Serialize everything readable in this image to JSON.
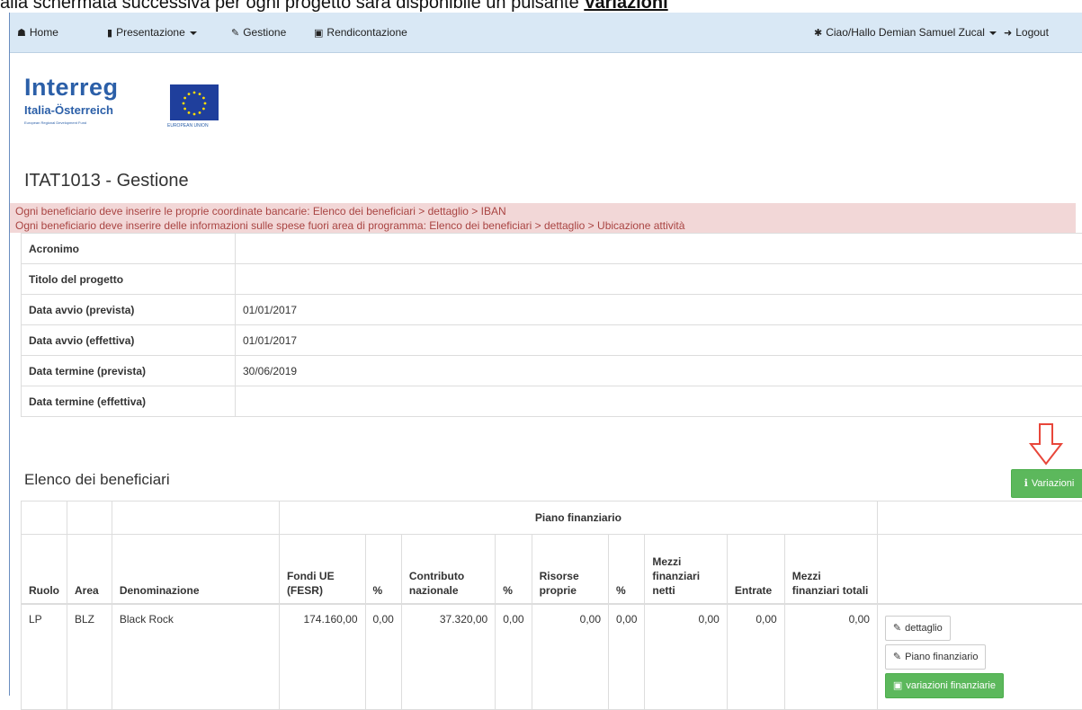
{
  "caption": {
    "text": "alla schermata successiva per ogni progetto sarà disponibile un pulsante ",
    "emphasis": "Variazioni"
  },
  "navbar": {
    "home": "Home",
    "presentazione": "Presentazione",
    "gestione": "Gestione",
    "rendicontazione": "Rendicontazione",
    "user": "Ciao/Hallo Demian Samuel Zucal",
    "logout": "Logout"
  },
  "logo": {
    "word": "Interreg",
    "sub": "Italia-Österreich",
    "fine": "European Regional Development Fund",
    "eu": "EUROPEAN UNION"
  },
  "page": {
    "title": "ITAT1013 - Gestione"
  },
  "alerts": [
    "Ogni beneficiario deve inserire le proprie coordinate bancarie: Elenco dei beneficiari > dettaglio > IBAN",
    "Ogni beneficiario deve inserire delle informazioni sulle spese fuori area di programma: Elenco dei beneficiari > dettaglio > Ubicazione attività"
  ],
  "project_info": [
    {
      "label": "Acronimo",
      "value": ""
    },
    {
      "label": "Titolo del progetto",
      "value": ""
    },
    {
      "label": "Data avvio (prevista)",
      "value": "01/01/2017"
    },
    {
      "label": "Data avvio (effettiva)",
      "value": "01/01/2017"
    },
    {
      "label": "Data termine (prevista)",
      "value": "30/06/2019"
    },
    {
      "label": "Data termine (effettiva)",
      "value": ""
    }
  ],
  "beneficiaries": {
    "title": "Elenco dei beneficiari",
    "variazioni_button": "Variazioni",
    "group_header": "Piano finanziario",
    "columns": {
      "ruolo": "Ruolo",
      "area": "Area",
      "denominazione": "Denominazione",
      "fondi_ue": "Fondi UE (FESR)",
      "pct1": "%",
      "contributo": "Contributo nazionale",
      "pct2": "%",
      "risorse": "Risorse proprie",
      "pct3": "%",
      "mezzi_netti": "Mezzi finanziari netti",
      "entrate": "Entrate",
      "mezzi_totali": "Mezzi finanziari totali"
    },
    "rows": [
      {
        "ruolo": "LP",
        "area": "BLZ",
        "denominazione": "Black Rock",
        "fondi_ue": "174.160,00",
        "pct1": "0,00",
        "contributo": "37.320,00",
        "pct2": "0,00",
        "risorse": "0,00",
        "pct3": "0,00",
        "mezzi_netti": "0,00",
        "entrate": "0,00",
        "mezzi_totali": "0,00"
      }
    ],
    "actions": {
      "dettaglio": "dettaglio",
      "piano": "Piano finanziario",
      "variazioni_finanziarie": "variazioni finanziarie"
    }
  },
  "colors": {
    "navbar_bg": "#d9e8f5",
    "alert_bg": "#f2d7d7",
    "alert_text": "#a94442",
    "success": "#5cb85c",
    "annotation_arrow": "#e8463a",
    "brand_blue": "#2b5fa8"
  }
}
